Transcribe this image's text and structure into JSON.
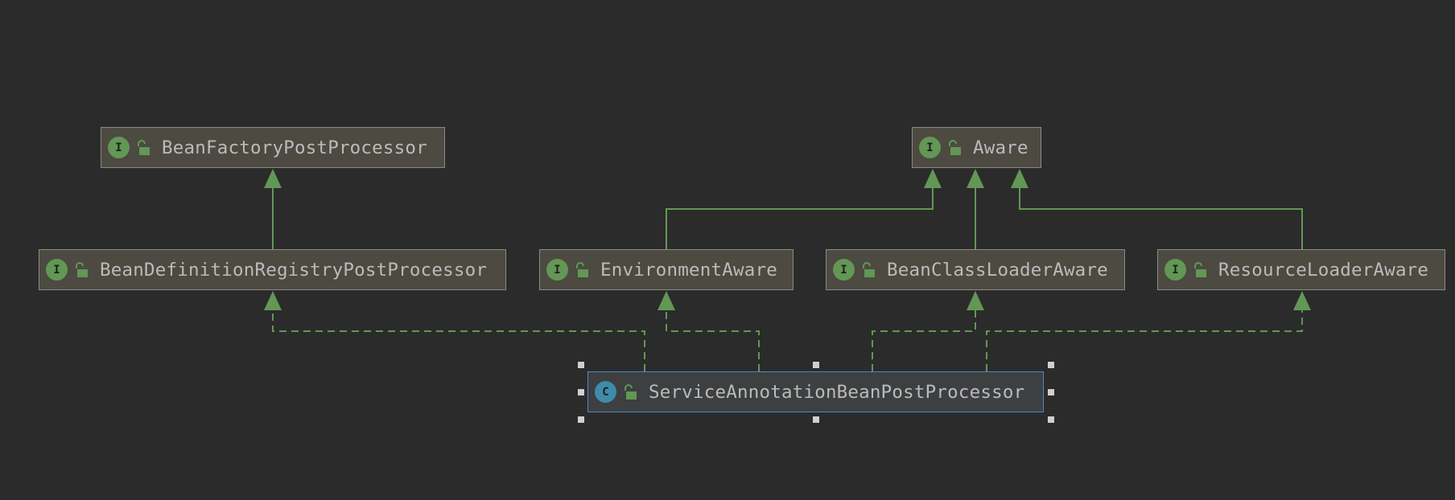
{
  "colors": {
    "background": "#2b2b2b",
    "node_fill": "#4c4a41",
    "node_border": "#8a8a85",
    "edge": "#629755",
    "interface_badge": "#629755",
    "class_badge": "#3f8baa",
    "selection": "#4a88c7",
    "text": "#bbbbbb"
  },
  "nodes": {
    "bean_factory_post_processor": {
      "badge": "I",
      "label": "BeanFactoryPostProcessor",
      "icon": "unlocked-padlock-icon"
    },
    "aware": {
      "badge": "I",
      "label": "Aware",
      "icon": "unlocked-padlock-icon"
    },
    "bean_definition_registry_post_processor": {
      "badge": "I",
      "label": "BeanDefinitionRegistryPostProcessor",
      "icon": "unlocked-padlock-icon"
    },
    "environment_aware": {
      "badge": "I",
      "label": "EnvironmentAware",
      "icon": "unlocked-padlock-icon"
    },
    "bean_class_loader_aware": {
      "badge": "I",
      "label": "BeanClassLoaderAware",
      "icon": "unlocked-padlock-icon"
    },
    "resource_loader_aware": {
      "badge": "I",
      "label": "ResourceLoaderAware",
      "icon": "unlocked-padlock-icon"
    },
    "service_annotation_bean_post_processor": {
      "badge": "C",
      "label": "ServiceAnnotationBeanPostProcessor",
      "icon": "unlocked-padlock-icon",
      "selected": true
    }
  },
  "edges": [
    {
      "from": "bean_definition_registry_post_processor",
      "to": "bean_factory_post_processor",
      "style": "solid"
    },
    {
      "from": "environment_aware",
      "to": "aware",
      "style": "solid"
    },
    {
      "from": "bean_class_loader_aware",
      "to": "aware",
      "style": "solid"
    },
    {
      "from": "resource_loader_aware",
      "to": "aware",
      "style": "solid"
    },
    {
      "from": "service_annotation_bean_post_processor",
      "to": "bean_definition_registry_post_processor",
      "style": "dashed"
    },
    {
      "from": "service_annotation_bean_post_processor",
      "to": "environment_aware",
      "style": "dashed"
    },
    {
      "from": "service_annotation_bean_post_processor",
      "to": "bean_class_loader_aware",
      "style": "dashed"
    },
    {
      "from": "service_annotation_bean_post_processor",
      "to": "resource_loader_aware",
      "style": "dashed"
    }
  ]
}
